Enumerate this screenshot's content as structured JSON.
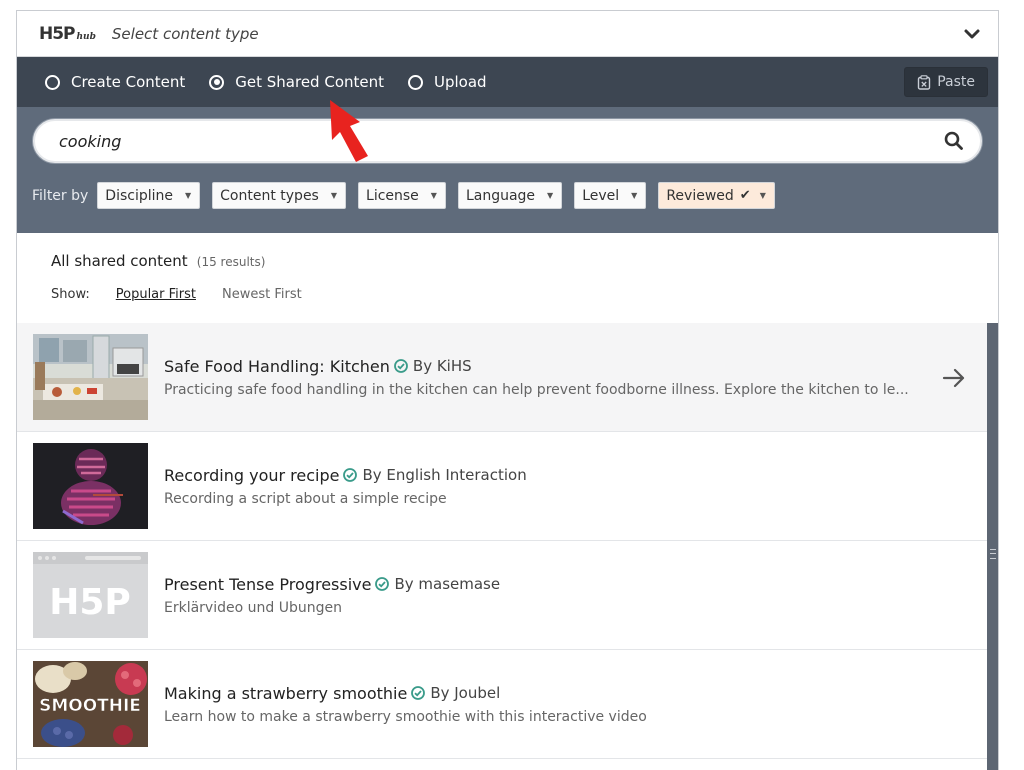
{
  "header": {
    "logo_main": "H5P",
    "logo_sub": "hub",
    "title": "Select content type"
  },
  "tabs": [
    {
      "label": "Create Content",
      "selected": false
    },
    {
      "label": "Get Shared Content",
      "selected": true
    },
    {
      "label": "Upload",
      "selected": false
    }
  ],
  "paste_label": "Paste",
  "search": {
    "value": "cooking"
  },
  "filters": {
    "label": "Filter by",
    "items": [
      "Discipline",
      "Content types",
      "License",
      "Language",
      "Level",
      "Reviewed"
    ]
  },
  "results": {
    "title": "All shared content",
    "count": "(15 results)",
    "show_label": "Show:",
    "sort_popular": "Popular First",
    "sort_newest": "Newest First"
  },
  "items": [
    {
      "title": "Safe Food Handling: Kitchen",
      "by": "By KiHS",
      "desc": "Practicing safe food handling in the kitchen can help prevent foodborne illness. Explore the kitchen to le..."
    },
    {
      "title": "Recording your recipe",
      "by": "By English Interaction",
      "desc": "Recording a script about a simple recipe"
    },
    {
      "title": "Present Tense Progressive",
      "by": "By masemase",
      "desc": "Erklärvideo und Übungen"
    },
    {
      "title": "Making a strawberry smoothie",
      "by": "By Joubel",
      "desc": "Learn how to make a strawberry smoothie with this interactive video"
    }
  ],
  "thumb_texts": {
    "h5p": "H5P",
    "smoothie": "SMOOTHIE"
  },
  "colors": {
    "tabs_bg": "#3d4652",
    "search_bg": "#5f6b7b",
    "verified": "#3a9b8a",
    "annotation": "#e8231f"
  }
}
